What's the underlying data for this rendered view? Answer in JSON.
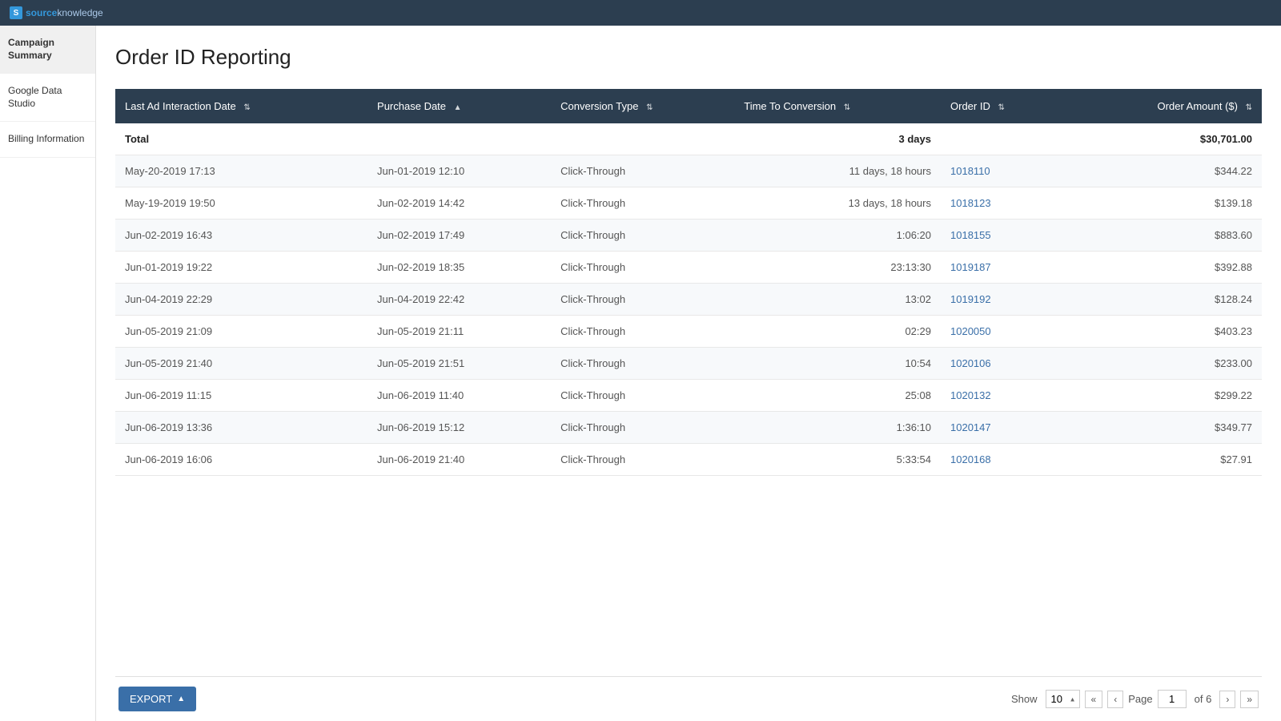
{
  "topbar": {
    "logo_source": "source",
    "logo_knowledge": "knowledge"
  },
  "sidebar": {
    "items": [
      {
        "label": "Campaign Summary",
        "active": true
      },
      {
        "label": "Google Data Studio",
        "active": false
      },
      {
        "label": "Billing Information",
        "active": false
      }
    ]
  },
  "page": {
    "title": "Order ID Reporting"
  },
  "table": {
    "columns": [
      {
        "label": "Last Ad Interaction Date",
        "sortable": true
      },
      {
        "label": "Purchase Date",
        "sortable": true,
        "sort_dir": "asc"
      },
      {
        "label": "Conversion Type",
        "sortable": true
      },
      {
        "label": "Time To Conversion",
        "sortable": true
      },
      {
        "label": "Order ID",
        "sortable": true
      },
      {
        "label": "Order Amount ($)",
        "sortable": true
      }
    ],
    "total_row": {
      "label": "Total",
      "time_to_conversion": "3 days",
      "order_amount": "$30,701.00"
    },
    "rows": [
      {
        "last_ad": "May-20-2019 17:13",
        "purchase": "Jun-01-2019 12:10",
        "conv_type": "Click-Through",
        "time_conv": "11 days, 18 hours",
        "order_id": "1018110",
        "amount": "$344.22"
      },
      {
        "last_ad": "May-19-2019 19:50",
        "purchase": "Jun-02-2019 14:42",
        "conv_type": "Click-Through",
        "time_conv": "13 days, 18 hours",
        "order_id": "1018123",
        "amount": "$139.18"
      },
      {
        "last_ad": "Jun-02-2019 16:43",
        "purchase": "Jun-02-2019 17:49",
        "conv_type": "Click-Through",
        "time_conv": "1:06:20",
        "order_id": "1018155",
        "amount": "$883.60"
      },
      {
        "last_ad": "Jun-01-2019 19:22",
        "purchase": "Jun-02-2019 18:35",
        "conv_type": "Click-Through",
        "time_conv": "23:13:30",
        "order_id": "1019187",
        "amount": "$392.88"
      },
      {
        "last_ad": "Jun-04-2019 22:29",
        "purchase": "Jun-04-2019 22:42",
        "conv_type": "Click-Through",
        "time_conv": "13:02",
        "order_id": "1019192",
        "amount": "$128.24"
      },
      {
        "last_ad": "Jun-05-2019 21:09",
        "purchase": "Jun-05-2019 21:11",
        "conv_type": "Click-Through",
        "time_conv": "02:29",
        "order_id": "1020050",
        "amount": "$403.23"
      },
      {
        "last_ad": "Jun-05-2019 21:40",
        "purchase": "Jun-05-2019 21:51",
        "conv_type": "Click-Through",
        "time_conv": "10:54",
        "order_id": "1020106",
        "amount": "$233.00"
      },
      {
        "last_ad": "Jun-06-2019 11:15",
        "purchase": "Jun-06-2019 11:40",
        "conv_type": "Click-Through",
        "time_conv": "25:08",
        "order_id": "1020132",
        "amount": "$299.22"
      },
      {
        "last_ad": "Jun-06-2019 13:36",
        "purchase": "Jun-06-2019 15:12",
        "conv_type": "Click-Through",
        "time_conv": "1:36:10",
        "order_id": "1020147",
        "amount": "$349.77"
      },
      {
        "last_ad": "Jun-06-2019 16:06",
        "purchase": "Jun-06-2019 21:40",
        "conv_type": "Click-Through",
        "time_conv": "5:33:54",
        "order_id": "1020168",
        "amount": "$27.91"
      }
    ]
  },
  "footer": {
    "export_label": "EXPORT",
    "show_label": "Show",
    "show_value": "10",
    "page_label": "Page",
    "page_current": "1",
    "page_total": "6"
  }
}
